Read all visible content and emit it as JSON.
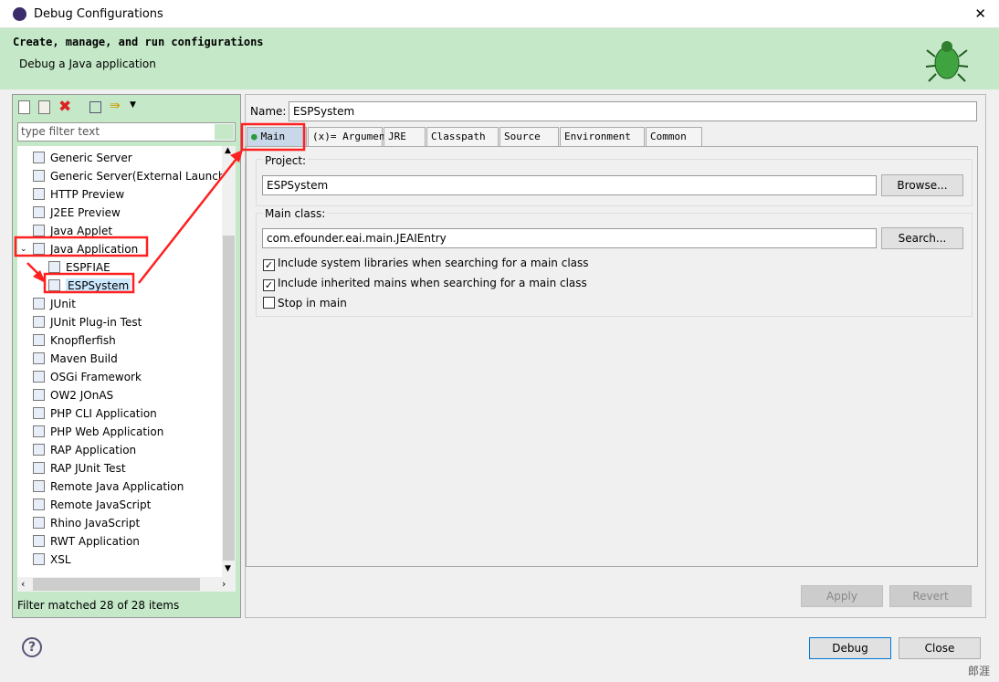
{
  "window": {
    "title": "Debug Configurations",
    "close_glyph": "✕"
  },
  "header": {
    "title": "Create, manage, and run configurations",
    "subtitle": "Debug a Java application"
  },
  "left": {
    "filter_placeholder": "type filter text",
    "status": "Filter matched 28 of 28 items",
    "tree": [
      {
        "label": "Generic Server",
        "level": 0,
        "icon": "server-icon"
      },
      {
        "label": "Generic Server(External Launch)",
        "level": 0,
        "icon": "server-icon"
      },
      {
        "label": "HTTP Preview",
        "level": 0,
        "icon": "server-icon"
      },
      {
        "label": "J2EE Preview",
        "level": 0,
        "icon": "server-icon"
      },
      {
        "label": "Java Applet",
        "level": 0,
        "icon": "applet-icon"
      },
      {
        "label": "Java Application",
        "level": 0,
        "icon": "java-app-icon",
        "expanded": true
      },
      {
        "label": "ESPFIAE",
        "level": 1,
        "icon": "java-app-icon"
      },
      {
        "label": "ESPSystem",
        "level": 1,
        "icon": "java-app-icon",
        "selected": true
      },
      {
        "label": "JUnit",
        "level": 0,
        "icon": "junit-icon"
      },
      {
        "label": "JUnit Plug-in Test",
        "level": 0,
        "icon": "junit-icon"
      },
      {
        "label": "Knopflerfish",
        "level": 0,
        "icon": "knopflerfish-icon"
      },
      {
        "label": "Maven Build",
        "level": 0,
        "icon": "maven-icon"
      },
      {
        "label": "OSGi Framework",
        "level": 0,
        "icon": "osgi-icon"
      },
      {
        "label": "OW2 JOnAS",
        "level": 0,
        "icon": "jonas-icon"
      },
      {
        "label": "PHP CLI Application",
        "level": 0,
        "icon": "php-icon"
      },
      {
        "label": "PHP Web Application",
        "level": 0,
        "icon": "php-icon"
      },
      {
        "label": "RAP Application",
        "level": 0,
        "icon": "rap-icon"
      },
      {
        "label": "RAP JUnit Test",
        "level": 0,
        "icon": "junit-icon"
      },
      {
        "label": "Remote Java Application",
        "level": 0,
        "icon": "remote-java-icon"
      },
      {
        "label": "Remote JavaScript",
        "level": 0,
        "icon": "javascript-icon"
      },
      {
        "label": "Rhino JavaScript",
        "level": 0,
        "icon": "rhino-icon"
      },
      {
        "label": "RWT Application",
        "level": 0,
        "icon": "rwt-icon"
      },
      {
        "label": "XSL",
        "level": 0,
        "icon": "xsl-icon"
      }
    ]
  },
  "right": {
    "name_label": "Name:",
    "name_value": "ESPSystem",
    "tabs": [
      {
        "label": "Main",
        "active": true
      },
      {
        "label": "(x)= Arguments"
      },
      {
        "label": "JRE"
      },
      {
        "label": "Classpath"
      },
      {
        "label": "Source"
      },
      {
        "label": "Environment"
      },
      {
        "label": "Common"
      }
    ],
    "project_label": "Project:",
    "project_value": "ESPSystem",
    "browse": "Browse...",
    "main_class_label": "Main class:",
    "main_class_value": "com.efounder.eai.main.JEAIEntry",
    "search": "Search...",
    "checks": [
      {
        "label": "Include system libraries when searching for a main class",
        "checked": true
      },
      {
        "label": "Include inherited mains when searching for a main class",
        "checked": true
      },
      {
        "label": "Stop in main",
        "checked": false
      }
    ],
    "apply": "Apply",
    "revert": "Revert"
  },
  "footer": {
    "debug": "Debug",
    "close": "Close",
    "help": "?"
  },
  "watermark": "郎涯",
  "colors": {
    "header_bg": "#c4e8c8",
    "annotation": "#ff2020"
  }
}
